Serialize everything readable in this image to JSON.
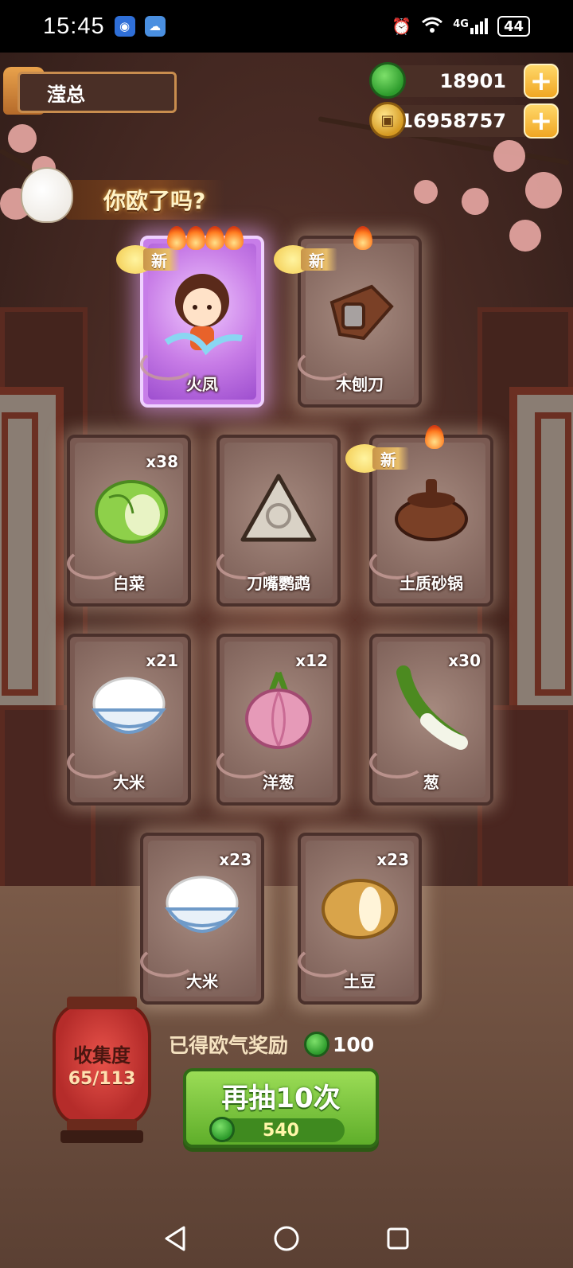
{
  "status_bar": {
    "time": "15:45",
    "network": "4G",
    "battery": "44"
  },
  "player": {
    "name": "滢总"
  },
  "currencies": {
    "jade": "18901",
    "coins": "16958757"
  },
  "banner": {
    "text": "你欧了吗?"
  },
  "new_badge": "新",
  "cards": [
    {
      "name": "火凤",
      "count": "",
      "rarity": "epic",
      "is_new": true,
      "flames": 4
    },
    {
      "name": "木刨刀",
      "count": "",
      "rarity": "normal",
      "is_new": true,
      "flames": 1
    },
    {
      "name": "白菜",
      "count": "x38",
      "rarity": "normal",
      "is_new": false,
      "flames": 0
    },
    {
      "name": "刀嘴鹦鹉",
      "count": "",
      "rarity": "normal",
      "is_new": false,
      "flames": 0
    },
    {
      "name": "土质砂锅",
      "count": "",
      "rarity": "normal",
      "is_new": true,
      "flames": 1
    },
    {
      "name": "大米",
      "count": "x21",
      "rarity": "normal",
      "is_new": false,
      "flames": 0
    },
    {
      "name": "洋葱",
      "count": "x12",
      "rarity": "normal",
      "is_new": false,
      "flames": 0
    },
    {
      "name": "葱",
      "count": "x30",
      "rarity": "normal",
      "is_new": false,
      "flames": 0
    },
    {
      "name": "大米",
      "count": "x23",
      "rarity": "normal",
      "is_new": false,
      "flames": 0
    },
    {
      "name": "土豆",
      "count": "x23",
      "rarity": "normal",
      "is_new": false,
      "flames": 0
    }
  ],
  "collection": {
    "title": "收集度",
    "progress": "65/113"
  },
  "reward": {
    "label": "已得欧气奖励",
    "value": "100"
  },
  "draw_button": {
    "label": "再抽10次",
    "cost": "540"
  },
  "colors": {
    "jade": "#2d9b2c",
    "coin": "#d59a22",
    "epic_card": "#c77de8",
    "button_green": "#5fae2a"
  }
}
